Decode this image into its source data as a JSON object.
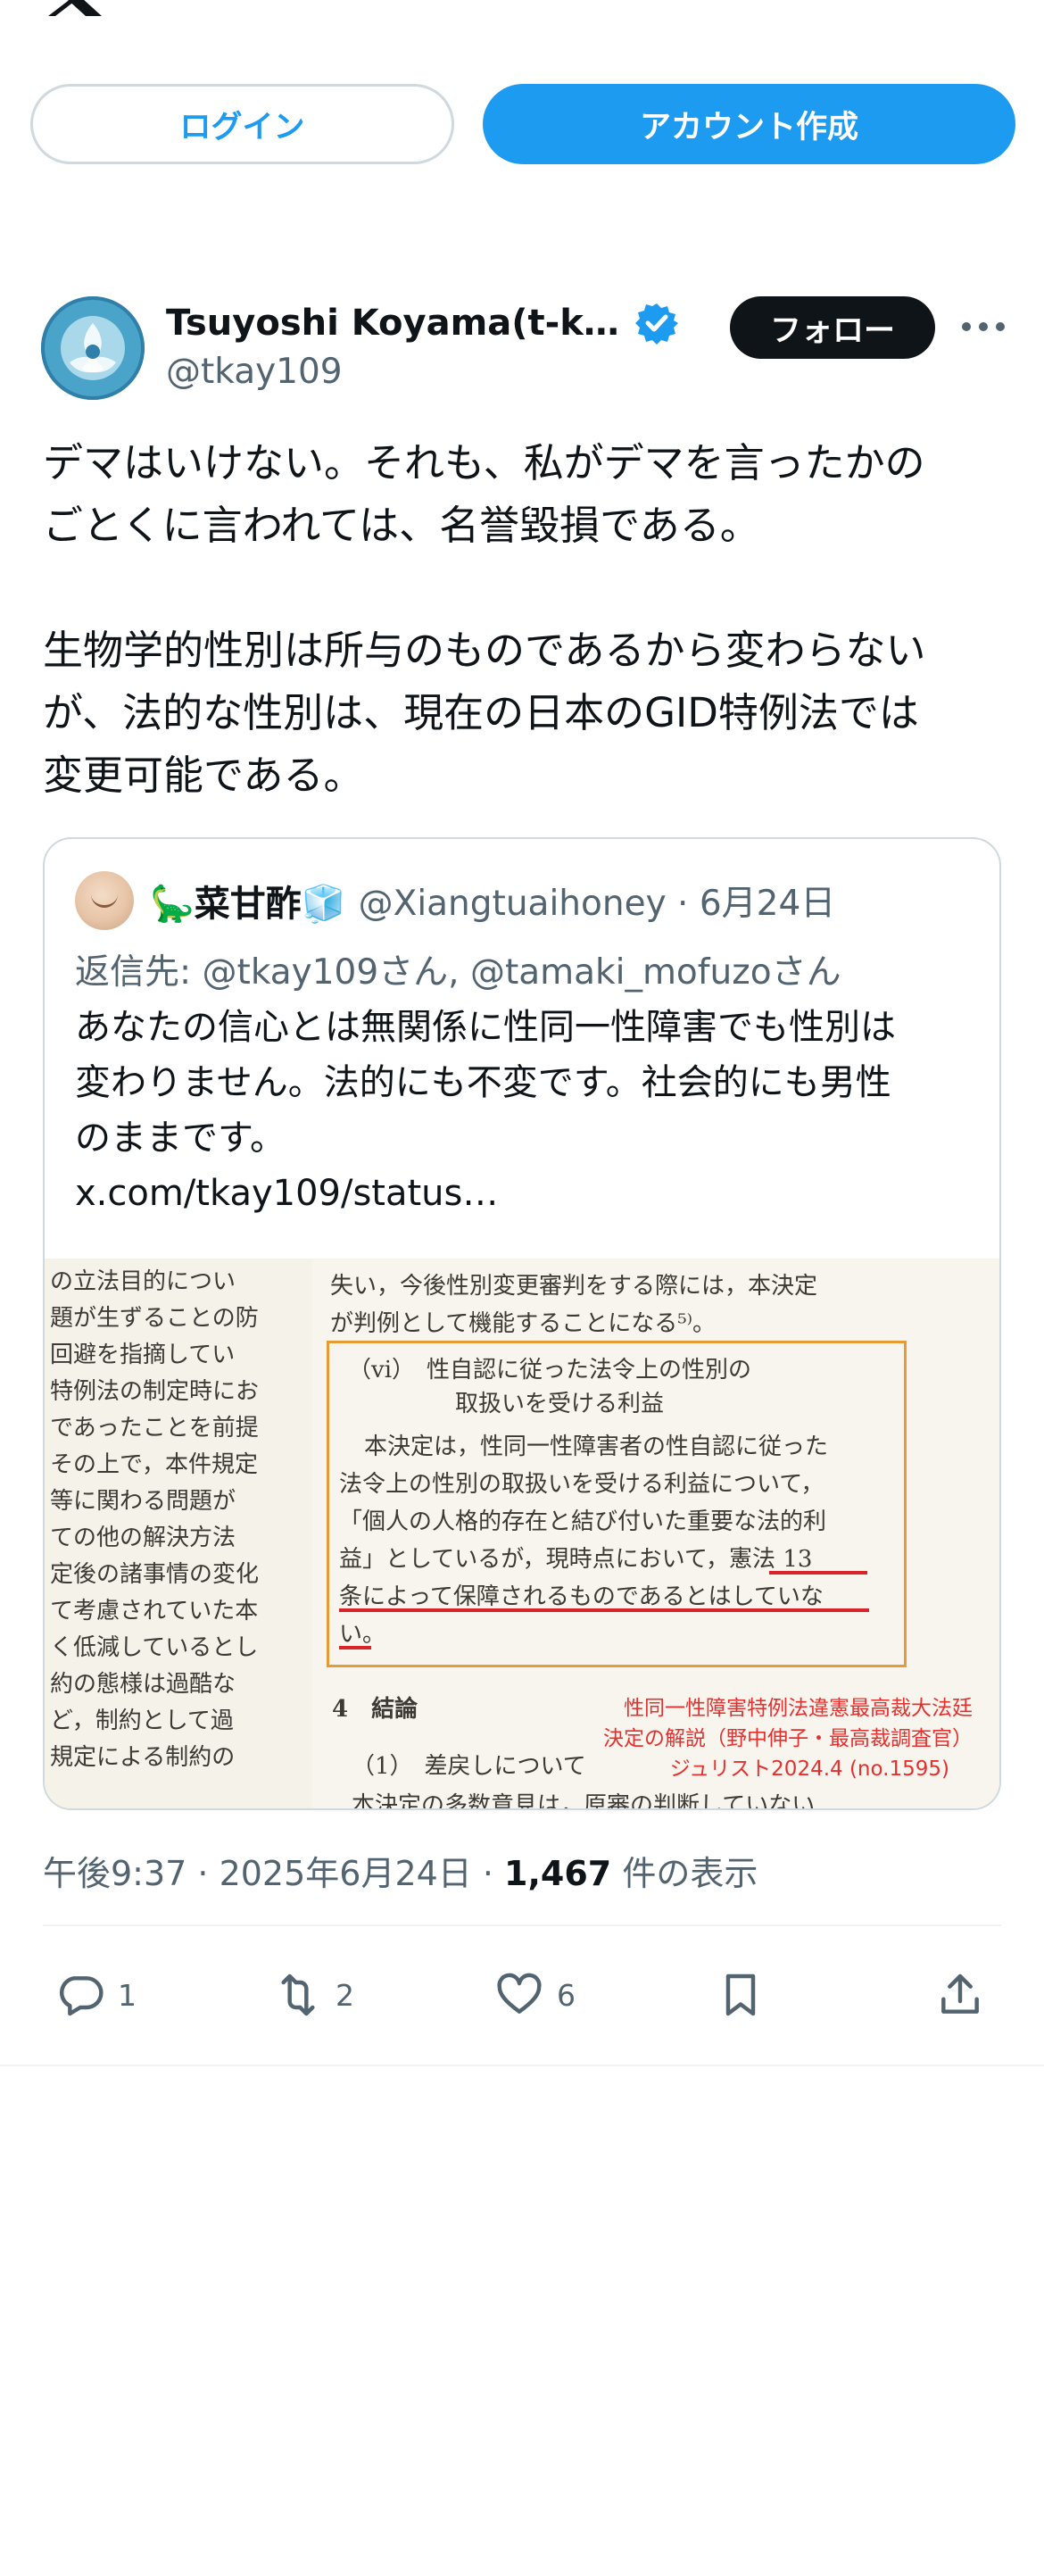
{
  "auth": {
    "login_label": "ログイン",
    "signup_label": "アカウント作成"
  },
  "author": {
    "name": "Tsuyoshi Koyama(t-k…",
    "handle": "@tkay109",
    "follow_label": "フォロー",
    "verified": true
  },
  "tweet": {
    "lines": [
      "デマはいけない。それも、私がデマを言ったかの",
      "ごとくに言われては、名誉毀損である。",
      "",
      "生物学的性別は所与のものであるから変わらない",
      "が、法的な性別は、現在の日本のGID特例法では",
      "変更可能である。"
    ]
  },
  "quote": {
    "name": "🦕菜甘酢🧊",
    "handle_date": "@Xiangtuaihoney · 6月24日",
    "reply_to": "返信先: @tkay109さん, @tamaki_mofuzoさん",
    "lines": [
      "あなたの信心とは無関係に性同一性障害でも性別は",
      "変わりません。法的にも不変です。社会的にも男性",
      "のままです。",
      "x.com/tkay109/status…"
    ],
    "image": {
      "left_column": [
        "の立法目的につい",
        "題が生ずることの防",
        "回避を指摘してい",
        "特例法の制定時にお",
        "であったことを前提",
        "その上で，本件規定",
        "等に関わる問題が",
        "ての他の解決方法",
        "定後の諸事情の変化",
        "て考慮されていた本",
        "く低減しているとし",
        "約の態様は過酷な",
        "ど，制約として過",
        "規定による制約の"
      ],
      "top_lines": [
        "失い，今後性別変更審判をする際には，本決定",
        "が判例として機能することになる⁵⁾。"
      ],
      "box_heading_1": "（vi）　性自認に従った法令上の性別の",
      "box_heading_2": "取扱いを受ける利益",
      "box_lines": [
        "本決定は，性同一性障害者の性自認に従った",
        "法令上の性別の取扱いを受ける利益について，",
        "「個人の人格的存在と結び付いた重要な法的利",
        "益」としているが，現時点において，憲法 13",
        "条によって保障されるものであるとはしていな",
        "い。"
      ],
      "section_heading": "4　結論",
      "sub_heading": "（1）　差戻しについて",
      "last_line": "本決定の多数意見は，原審の判断していない",
      "notes": [
        "性同一性障害特例法違憲最高裁大法廷",
        "決定の解説（野中伸子・最高裁調査官）",
        "ジュリスト2024.4 (no.1595)"
      ]
    }
  },
  "meta": {
    "time": "午後9:37 · 2025年6月24日 · ",
    "views": "1,467",
    "views_label": " 件の表示"
  },
  "actions": {
    "replies": "1",
    "reposts": "2",
    "likes": "6"
  },
  "colors": {
    "accent": "#1d9bf0",
    "text": "#0f1419",
    "muted": "#536471",
    "border": "#cfd9de"
  }
}
